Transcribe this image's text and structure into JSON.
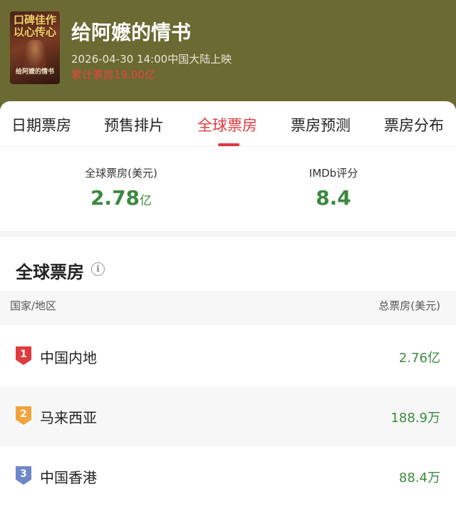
{
  "header": {
    "poster": {
      "title_line1": "口碑佳作",
      "title_line2": "以心传心",
      "subtitle": "给阿嬷的情书"
    },
    "movie_title": "给阿嬷的情书",
    "release_info": "2026-04-30 14:00中国大陆上映",
    "cumulative_box_office": "累计票房19.00亿"
  },
  "tabs": [
    {
      "label": "日期票房",
      "active": false
    },
    {
      "label": "预售排片",
      "active": false
    },
    {
      "label": "全球票房",
      "active": true
    },
    {
      "label": "票房预测",
      "active": false
    },
    {
      "label": "票房分布",
      "active": false
    }
  ],
  "summary": {
    "global_label": "全球票房(美元)",
    "global_value": "2.78",
    "global_unit": "亿",
    "imdb_label": "IMDb评分",
    "imdb_value": "8.4"
  },
  "section": {
    "title": "全球票房",
    "info_icon": "i"
  },
  "table": {
    "col_region": "国家/地区",
    "col_total": "总票房(美元)",
    "rows": [
      {
        "rank": "1",
        "region": "中国内地",
        "value": "2.76亿"
      },
      {
        "rank": "2",
        "region": "马来西亚",
        "value": "188.9万"
      },
      {
        "rank": "3",
        "region": "中国香港",
        "value": "88.4万"
      }
    ]
  },
  "colors": {
    "header_bg": "#6b6a33",
    "accent_red": "#e0393e",
    "value_green": "#3b8a3e"
  }
}
